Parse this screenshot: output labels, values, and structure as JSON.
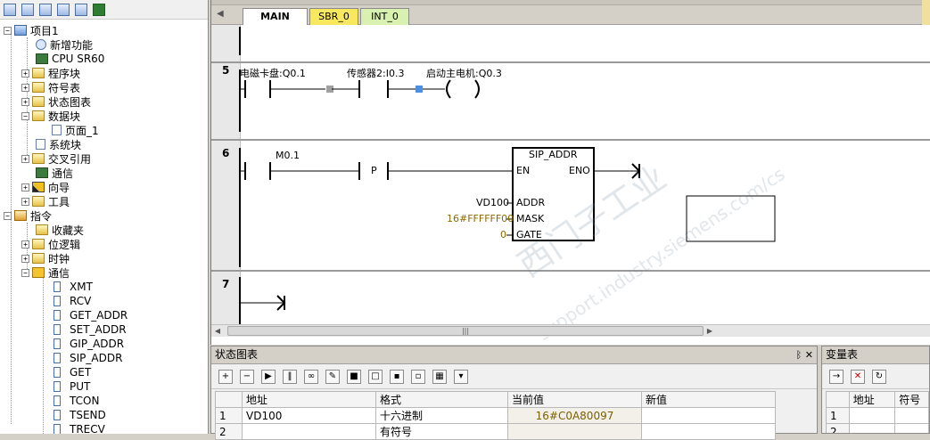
{
  "left": {
    "tree": [
      {
        "label": "项目1",
        "icon": "project-icon"
      },
      {
        "label": "新增功能",
        "icon": "help-icon"
      },
      {
        "label": "CPU SR60",
        "icon": "cpu-icon"
      },
      {
        "label": "程序块",
        "icon": "folder-icon"
      },
      {
        "label": "符号表",
        "icon": "folder-icon"
      },
      {
        "label": "状态图表",
        "icon": "folder-icon"
      },
      {
        "label": "数据块",
        "icon": "folder-icon"
      },
      {
        "label": "页面_1",
        "icon": "doc-icon"
      },
      {
        "label": "系统块",
        "icon": "doc-icon"
      },
      {
        "label": "交叉引用",
        "icon": "folder-icon"
      },
      {
        "label": "通信",
        "icon": "comm-icon"
      },
      {
        "label": "向导",
        "icon": "wizard-icon"
      },
      {
        "label": "工具",
        "icon": "folder-icon"
      },
      {
        "label": "指令",
        "icon": "instructions-icon"
      },
      {
        "label": "收藏夹",
        "icon": "folder-icon"
      },
      {
        "label": "位逻辑",
        "icon": "folder-icon"
      },
      {
        "label": "时钟",
        "icon": "folder-icon"
      },
      {
        "label": "通信",
        "icon": "comm-folder-icon"
      },
      {
        "label": "XMT",
        "icon": "block-icon"
      },
      {
        "label": "RCV",
        "icon": "block-icon"
      },
      {
        "label": "GET_ADDR",
        "icon": "block-icon"
      },
      {
        "label": "SET_ADDR",
        "icon": "block-icon"
      },
      {
        "label": "GIP_ADDR",
        "icon": "block-icon"
      },
      {
        "label": "SIP_ADDR",
        "icon": "block-icon"
      },
      {
        "label": "GET",
        "icon": "block-icon"
      },
      {
        "label": "PUT",
        "icon": "block-icon"
      },
      {
        "label": "TCON",
        "icon": "block-icon"
      },
      {
        "label": "TSEND",
        "icon": "block-icon"
      },
      {
        "label": "TRECV",
        "icon": "block-icon"
      }
    ]
  },
  "editor": {
    "tabs": [
      "MAIN",
      "SBR_0",
      "INT_0"
    ],
    "networks": {
      "n5": {
        "number": "5",
        "contact1": "电磁卡盘:Q0.1",
        "contact2": "传感器2:I0.3",
        "coil": "启动主电机:Q0.3"
      },
      "n6": {
        "number": "6",
        "contact1": "M0.1",
        "edge": "P",
        "box_title": "SIP_ADDR",
        "en": "EN",
        "eno": "ENO",
        "addr_label": "ADDR",
        "mask_label": "MASK",
        "gate_label": "GATE",
        "addr_val": "VD100",
        "mask_val": "16#FFFFFF00",
        "gate_val": "0"
      },
      "n7": {
        "number": "7"
      }
    },
    "watermark_line1": "西门子工业",
    "watermark_line2": "support.industry.siemens.com/cs"
  },
  "status_chart": {
    "title": "状态图表",
    "title_buttons": "ᛒ  ✕",
    "headers": [
      "",
      "地址",
      "格式",
      "当前值",
      "新值"
    ],
    "rows": [
      [
        "1",
        "VD100",
        "十六进制",
        "16#C0A80097",
        ""
      ],
      [
        "2",
        "",
        "有符号",
        "",
        ""
      ]
    ]
  },
  "var_table": {
    "title": "变量表",
    "headers": [
      "",
      "地址",
      "符号"
    ],
    "rows": [
      [
        "1",
        "",
        ""
      ],
      [
        "2",
        "",
        ""
      ]
    ]
  }
}
